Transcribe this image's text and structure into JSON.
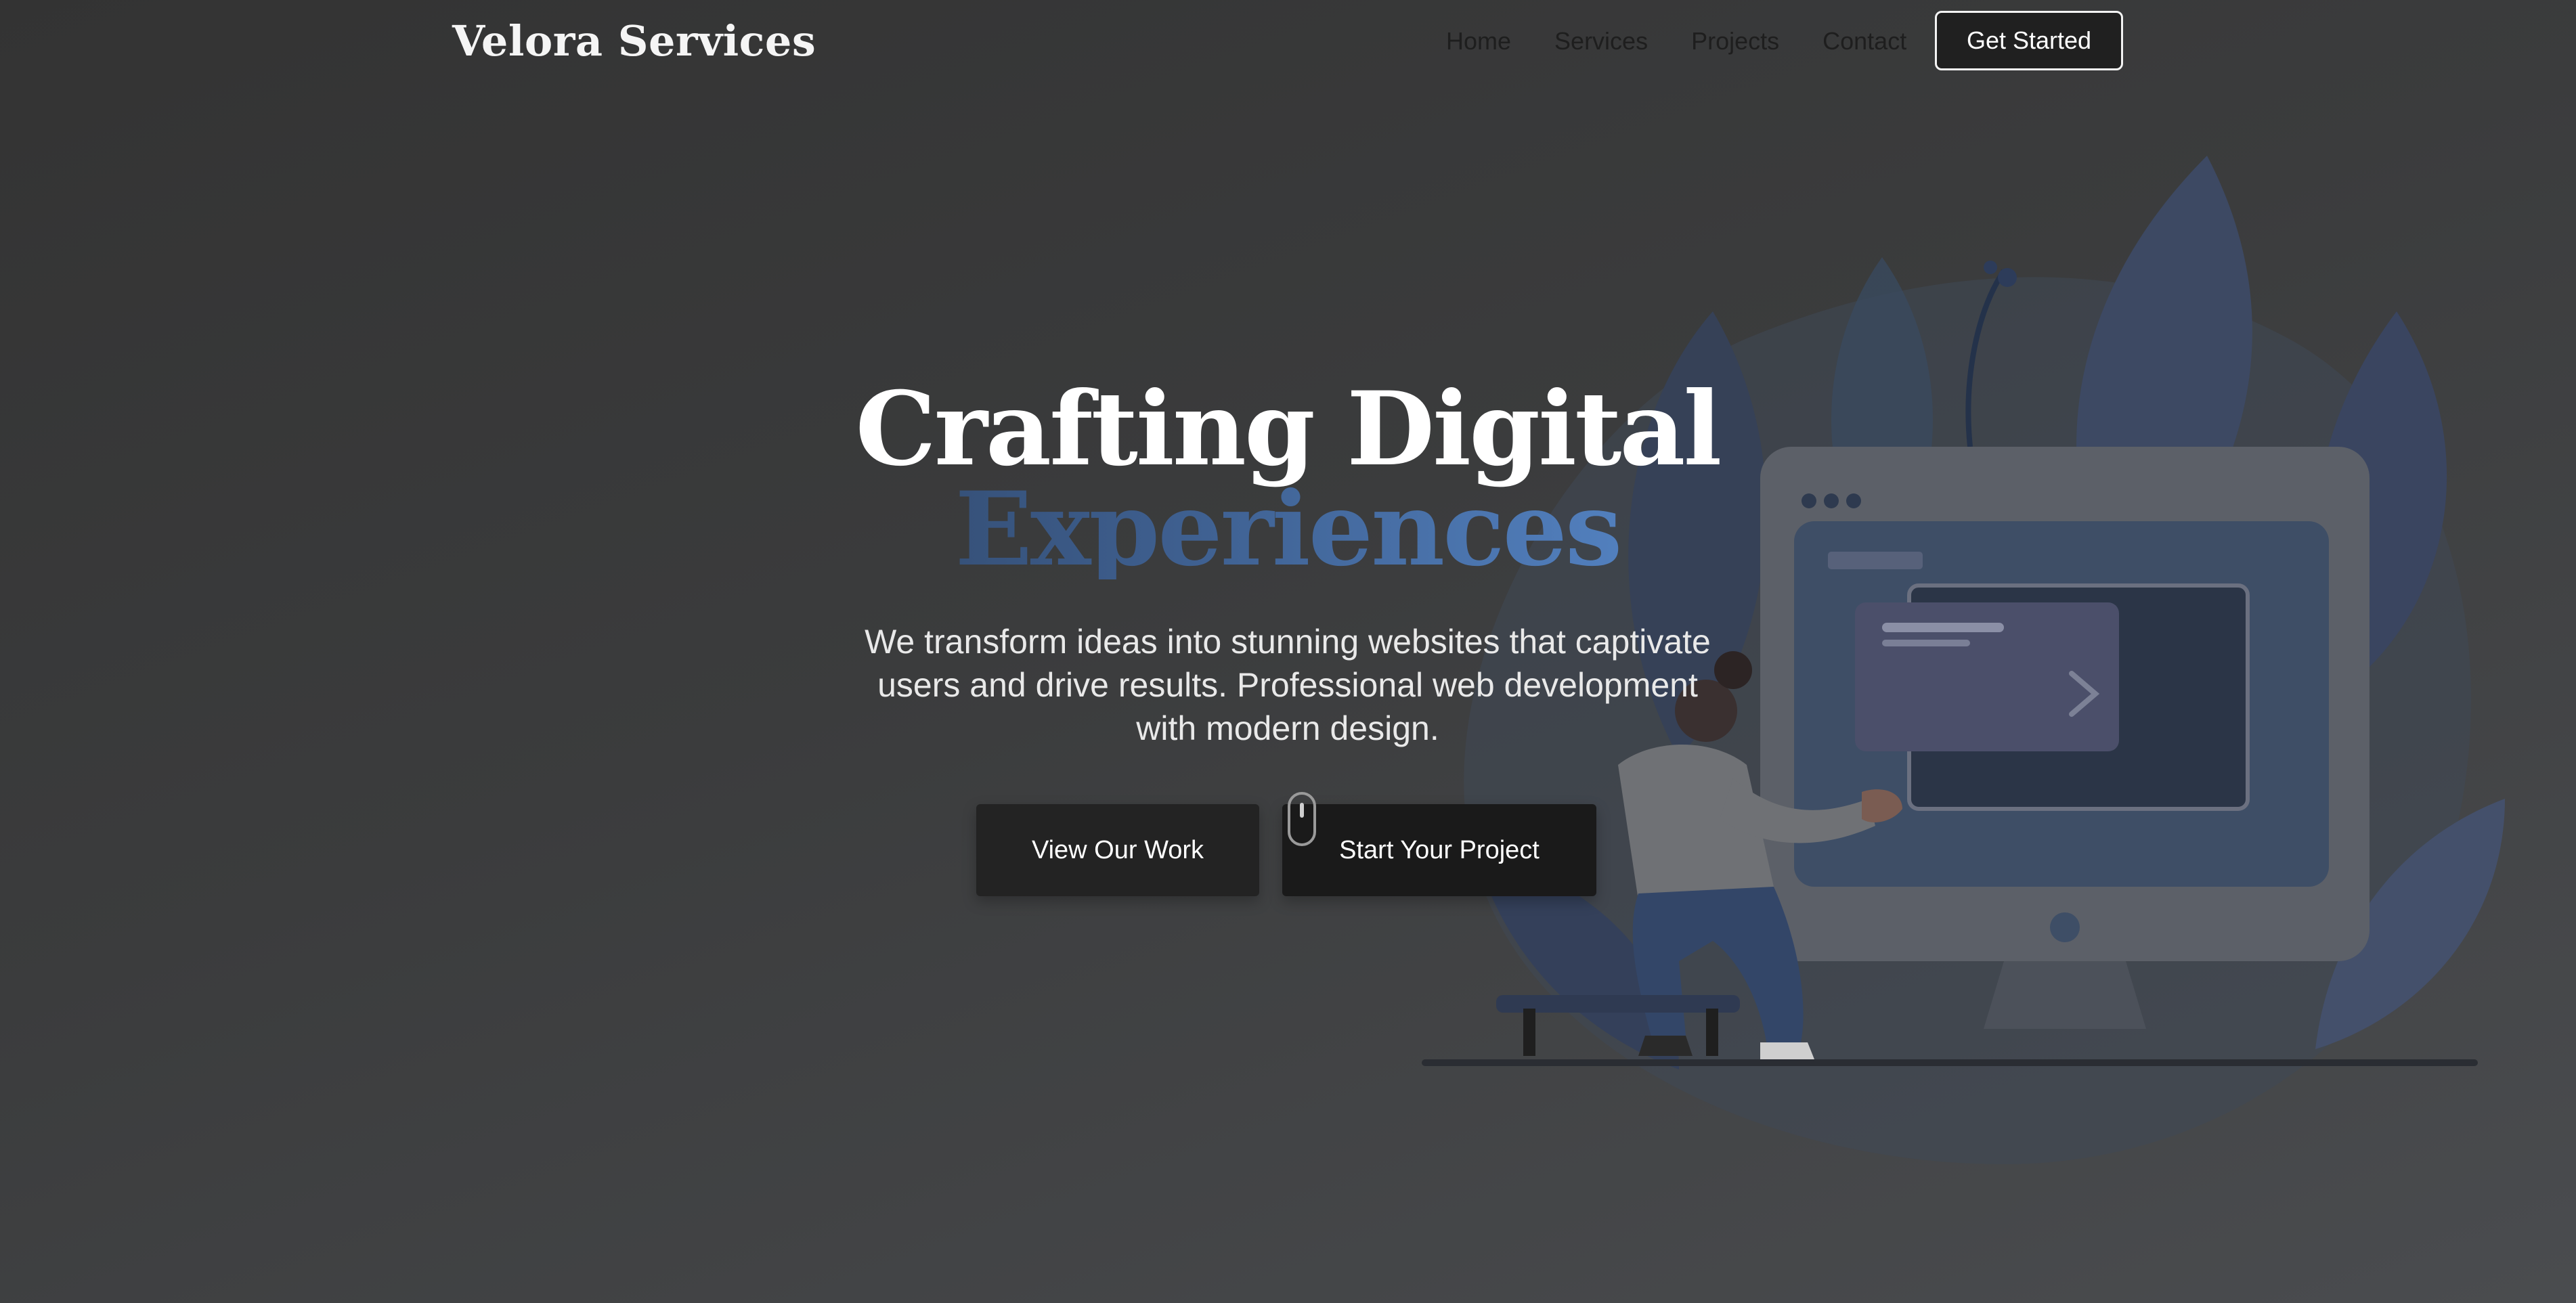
{
  "header": {
    "brand": "Velora Services",
    "nav": [
      "Home",
      "Services",
      "Projects",
      "Contact"
    ],
    "cta_label": "Get Started"
  },
  "hero": {
    "title_line1": "Crafting Digital",
    "title_line2": "Experiences",
    "subtitle": "We transform ideas into stunning websites that captivate users and drive results. Professional web development with modern design.",
    "primary_button": "View Our Work",
    "secondary_button": "Start Your Project"
  },
  "icons": {
    "scroll": "mouse-scroll-icon",
    "illustration": "developer-at-monitor-illustration"
  },
  "colors": {
    "background": "#3a3b3c",
    "accent": "#5b8fd4",
    "accent_dark": "#2f4566",
    "button_bg": "#1f1f1f"
  }
}
